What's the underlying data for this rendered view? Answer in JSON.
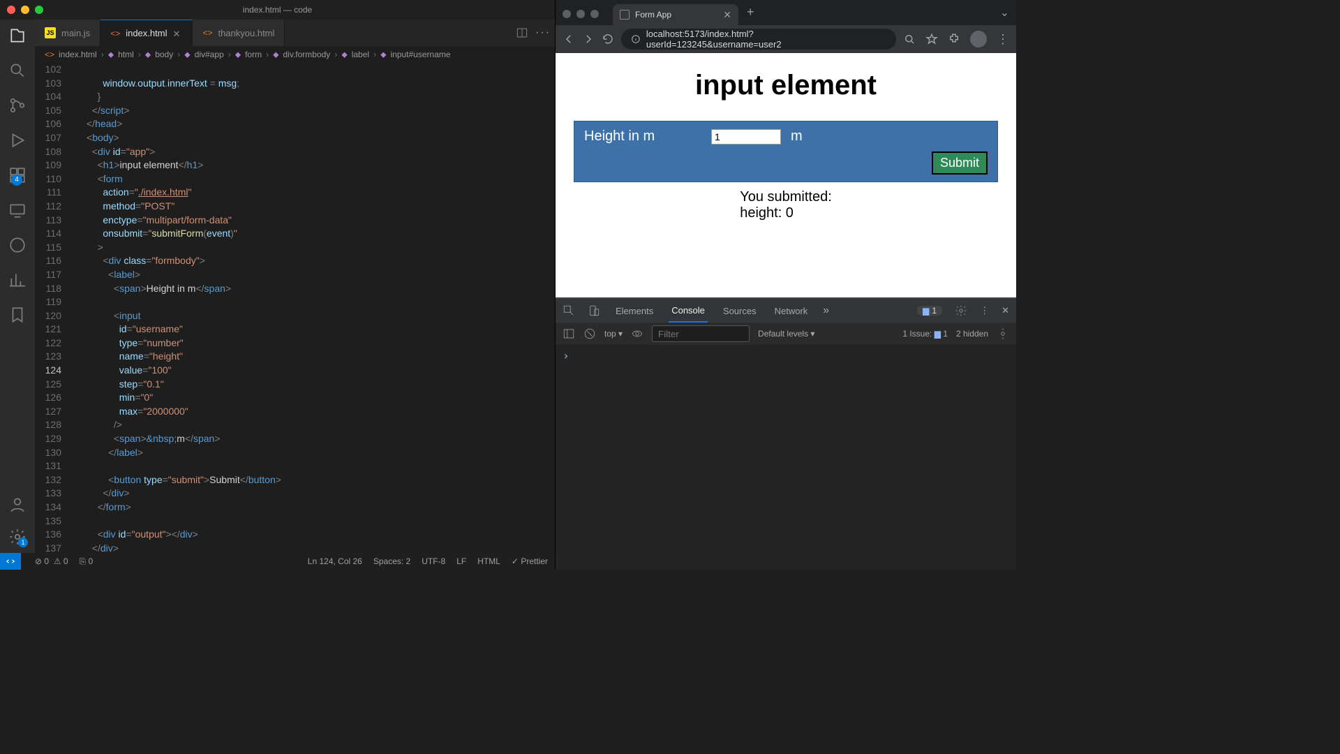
{
  "vscode": {
    "windowTitle": "index.html — code",
    "tabs": [
      {
        "label": "main.js",
        "lang": "JS"
      },
      {
        "label": "index.html",
        "lang": "<>",
        "active": true
      },
      {
        "label": "thankyou.html",
        "lang": "<>"
      }
    ],
    "breadcrumbs": [
      "index.html",
      "html",
      "body",
      "div#app",
      "form",
      "div.formbody",
      "label",
      "input#username"
    ],
    "extBadge": "4",
    "gearBadge": "1",
    "statusbar": {
      "errors": "0",
      "warnings": "0",
      "ports": "0",
      "cursor": "Ln 124, Col 26",
      "spaces": "Spaces: 2",
      "encoding": "UTF-8",
      "eol": "LF",
      "lang": "HTML",
      "prettier": "Prettier"
    },
    "startLine": 102,
    "currentLine": 124
  },
  "chrome": {
    "tabTitle": "Form App",
    "url": "localhost:5173/index.html?userId=123245&username=user2"
  },
  "webpage": {
    "heading": "input element",
    "label": "Height in m",
    "inputValue": "1",
    "unit": "m",
    "submit": "Submit",
    "outputLine1": "You submitted:",
    "outputLine2": "height: 0"
  },
  "devtools": {
    "tabs": [
      "Elements",
      "Console",
      "Sources",
      "Network"
    ],
    "activeTab": "Console",
    "msgCount": "1",
    "context": "top",
    "levels": "Default levels",
    "issuesLabel": "1 Issue:",
    "issuesCount": "1",
    "hidden": "2 hidden",
    "filterPlaceholder": "Filter"
  }
}
